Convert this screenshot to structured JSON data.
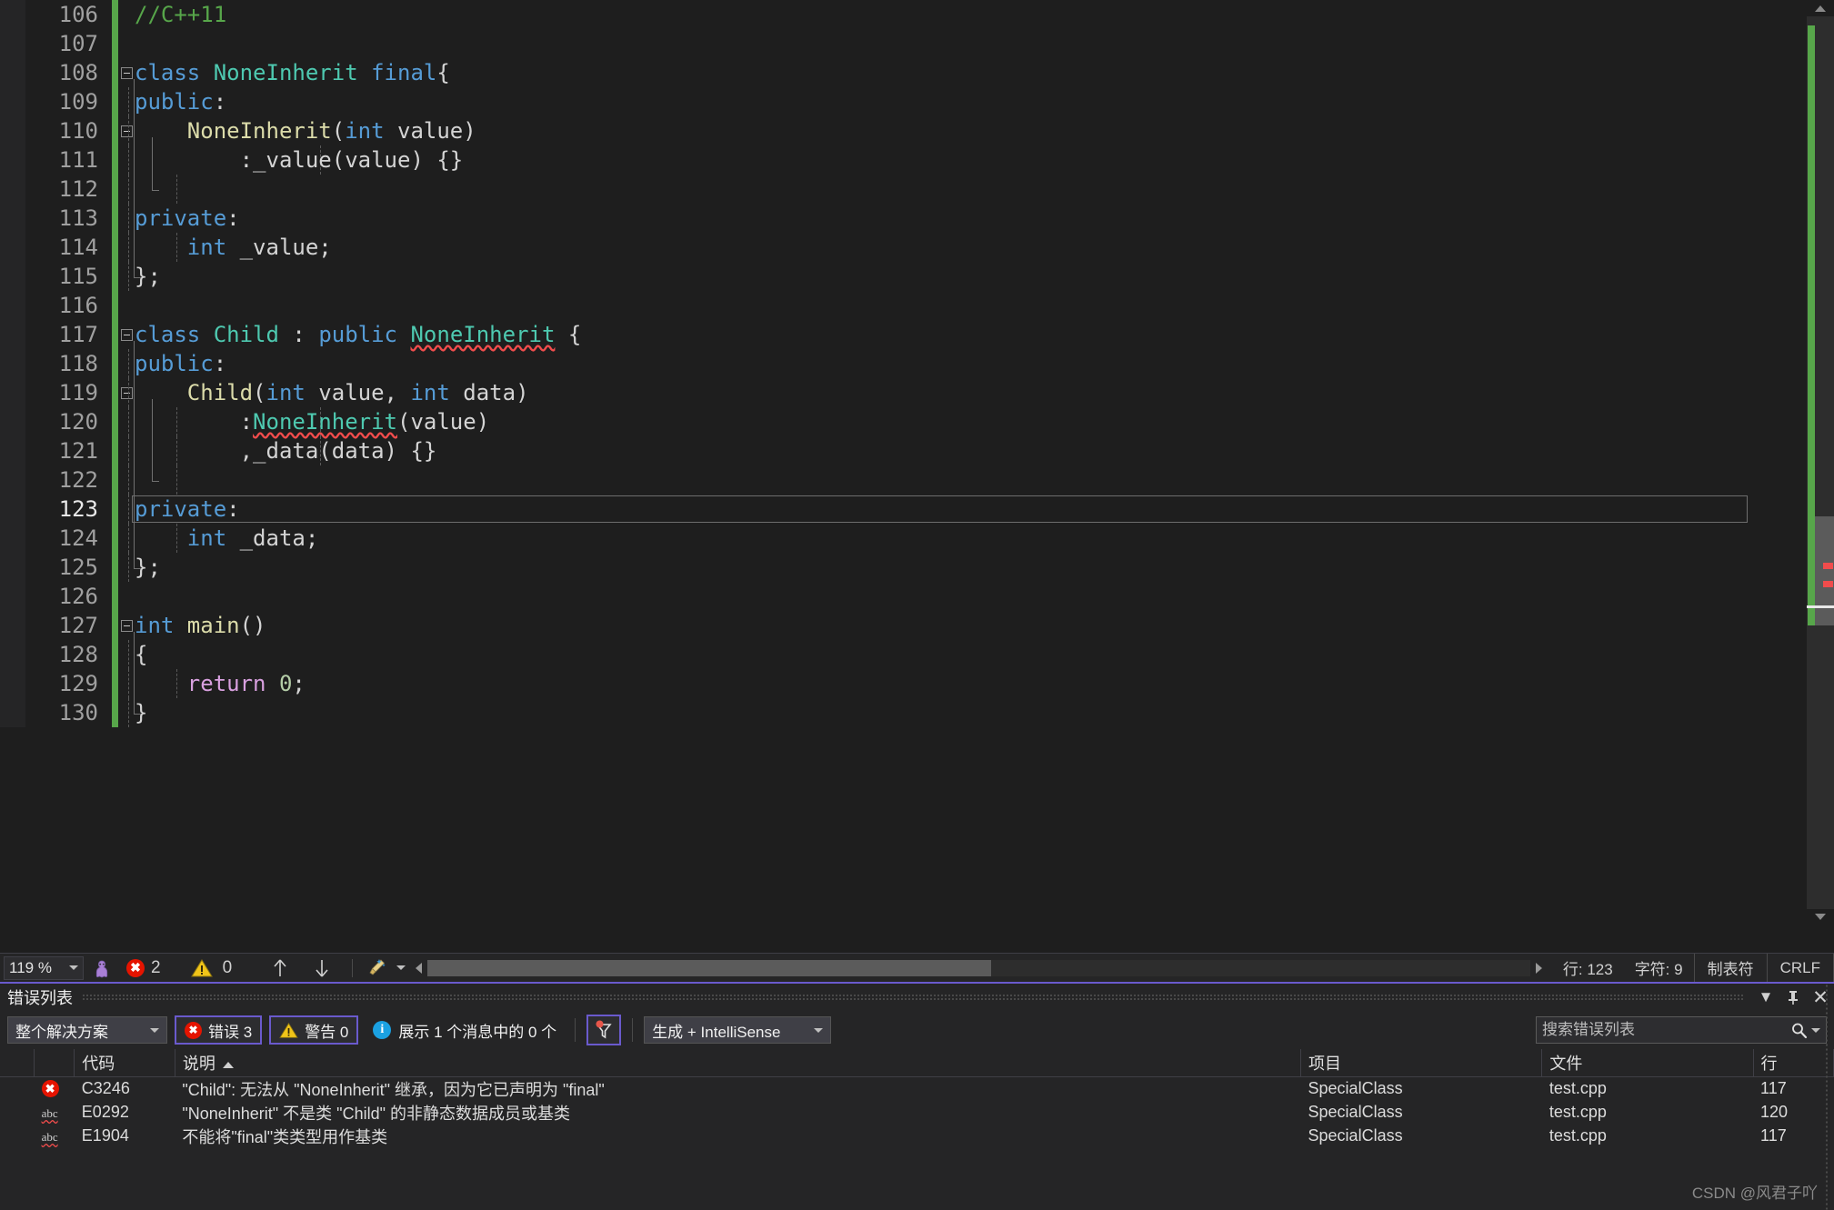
{
  "editor": {
    "first_line": 106,
    "current_line": 123,
    "lines": [
      {
        "n": 106,
        "fold": null,
        "tokens": [
          {
            "t": "//C++11",
            "c": "com"
          }
        ]
      },
      {
        "n": 107,
        "fold": null,
        "tokens": []
      },
      {
        "n": 108,
        "fold": "open",
        "tokens": [
          {
            "t": "class ",
            "c": "key"
          },
          {
            "t": "NoneInherit ",
            "c": "type"
          },
          {
            "t": "final",
            "c": "key"
          },
          {
            "t": "{",
            "c": "punct"
          }
        ]
      },
      {
        "n": 109,
        "fold": null,
        "tokens": [
          {
            "t": "public",
            "c": "key"
          },
          {
            "t": ":",
            "c": "punct"
          }
        ]
      },
      {
        "n": 110,
        "fold": "open",
        "tokens": [
          {
            "t": "    NoneInherit",
            "c": "fn"
          },
          {
            "t": "(",
            "c": "punct"
          },
          {
            "t": "int",
            "c": "key"
          },
          {
            "t": " value",
            "c": "id"
          },
          {
            "t": ")",
            "c": "punct"
          }
        ]
      },
      {
        "n": 111,
        "fold": null,
        "tokens": [
          {
            "t": "        :_value",
            "c": "id"
          },
          {
            "t": "(",
            "c": "punct"
          },
          {
            "t": "value",
            "c": "id"
          },
          {
            "t": ") {}",
            "c": "punct"
          }
        ]
      },
      {
        "n": 112,
        "fold": null,
        "tokens": []
      },
      {
        "n": 113,
        "fold": null,
        "tokens": [
          {
            "t": "private",
            "c": "key"
          },
          {
            "t": ":",
            "c": "punct"
          }
        ]
      },
      {
        "n": 114,
        "fold": null,
        "tokens": [
          {
            "t": "    int",
            "c": "key"
          },
          {
            "t": " _value;",
            "c": "id"
          }
        ]
      },
      {
        "n": 115,
        "fold": null,
        "tokens": [
          {
            "t": "};",
            "c": "punct"
          }
        ]
      },
      {
        "n": 116,
        "fold": null,
        "tokens": []
      },
      {
        "n": 117,
        "fold": "open",
        "tokens": [
          {
            "t": "class ",
            "c": "key"
          },
          {
            "t": "Child",
            "c": "type"
          },
          {
            "t": " : ",
            "c": "punct"
          },
          {
            "t": "public ",
            "c": "key"
          },
          {
            "t": "NoneInherit",
            "c": "type",
            "err": true
          },
          {
            "t": " {",
            "c": "punct"
          }
        ]
      },
      {
        "n": 118,
        "fold": null,
        "tokens": [
          {
            "t": "public",
            "c": "key"
          },
          {
            "t": ":",
            "c": "punct"
          }
        ]
      },
      {
        "n": 119,
        "fold": "open",
        "tokens": [
          {
            "t": "    Child",
            "c": "fn"
          },
          {
            "t": "(",
            "c": "punct"
          },
          {
            "t": "int",
            "c": "key"
          },
          {
            "t": " value, ",
            "c": "id"
          },
          {
            "t": "int",
            "c": "key"
          },
          {
            "t": " data",
            "c": "id"
          },
          {
            "t": ")",
            "c": "punct"
          }
        ]
      },
      {
        "n": 120,
        "fold": null,
        "tokens": [
          {
            "t": "        :",
            "c": "punct"
          },
          {
            "t": "NoneInherit",
            "c": "type",
            "err": true
          },
          {
            "t": "(",
            "c": "punct"
          },
          {
            "t": "value",
            "c": "id"
          },
          {
            "t": ")",
            "c": "punct"
          }
        ]
      },
      {
        "n": 121,
        "fold": null,
        "tokens": [
          {
            "t": "        ,_data",
            "c": "id"
          },
          {
            "t": "(",
            "c": "punct"
          },
          {
            "t": "data",
            "c": "id"
          },
          {
            "t": ") {}",
            "c": "punct"
          }
        ]
      },
      {
        "n": 122,
        "fold": null,
        "tokens": []
      },
      {
        "n": 123,
        "fold": null,
        "tokens": [
          {
            "t": "private",
            "c": "key"
          },
          {
            "t": ":",
            "c": "punct"
          }
        ]
      },
      {
        "n": 124,
        "fold": null,
        "tokens": [
          {
            "t": "    int",
            "c": "key"
          },
          {
            "t": " _data;",
            "c": "id"
          }
        ]
      },
      {
        "n": 125,
        "fold": null,
        "tokens": [
          {
            "t": "};",
            "c": "punct"
          }
        ]
      },
      {
        "n": 126,
        "fold": null,
        "tokens": []
      },
      {
        "n": 127,
        "fold": "open",
        "tokens": [
          {
            "t": "int ",
            "c": "key"
          },
          {
            "t": "main",
            "c": "fn"
          },
          {
            "t": "()",
            "c": "punct"
          }
        ]
      },
      {
        "n": 128,
        "fold": null,
        "tokens": [
          {
            "t": "{",
            "c": "punct"
          }
        ]
      },
      {
        "n": 129,
        "fold": null,
        "tokens": [
          {
            "t": "    return",
            "c": "ctrl"
          },
          {
            "t": " ",
            "c": "plain"
          },
          {
            "t": "0",
            "c": "num"
          },
          {
            "t": ";",
            "c": "punct"
          }
        ]
      },
      {
        "n": 130,
        "fold": null,
        "tokens": [
          {
            "t": "}",
            "c": "punct"
          }
        ]
      }
    ]
  },
  "statusbar": {
    "zoom": "119 %",
    "zoom_icon": "person-icon",
    "error_count": "2",
    "warning_count": "0",
    "prev_icon": "arrow-up-icon",
    "next_icon": "arrow-down-icon",
    "broom_icon": "broom-icon",
    "line_label": "行: 123",
    "char_label": "字符: 9",
    "tab_label": "制表符",
    "eol_label": "CRLF"
  },
  "errorpanel": {
    "title": "错误列表",
    "titlebar_buttons": [
      "chevron-down-icon",
      "pin-icon",
      "close-icon"
    ],
    "scope_filter": "整个解决方案",
    "errors_toggle": "错误 3",
    "warnings_toggle": "警告 0",
    "messages_toggle": "展示 1 个消息中的 0 个",
    "filter_icon": "funnel-filter-icon",
    "build_source": "生成 + IntelliSense",
    "search_placeholder": "搜索错误列表",
    "search_value": "",
    "columns": [
      "",
      "",
      "代码",
      "说明",
      "项目",
      "文件",
      "行"
    ],
    "sorted_column": "说明",
    "sort_direction": "asc",
    "rows": [
      {
        "icon": "error-icon",
        "code": "C3246",
        "description": "\"Child\": 无法从 \"NoneInherit\" 继承，因为它已声明为 \"final\"",
        "project": "SpecialClass",
        "file": "test.cpp",
        "line": "117"
      },
      {
        "icon": "intellisense-icon",
        "code": "E0292",
        "description": "\"NoneInherit\" 不是类 \"Child\" 的非静态数据成员或基类",
        "project": "SpecialClass",
        "file": "test.cpp",
        "line": "120"
      },
      {
        "icon": "intellisense-icon",
        "code": "E1904",
        "description": "不能将\"final\"类类型用作基类",
        "project": "SpecialClass",
        "file": "test.cpp",
        "line": "117"
      }
    ]
  },
  "watermark": "CSDN @风君子吖",
  "colors": {
    "accent": "#6a5acd",
    "error": "#e51400",
    "warning": "#ffcc00",
    "info": "#1ba1e2",
    "changed_line": "#57a64a",
    "keyword": "#569cd6",
    "type": "#4ec9b0",
    "comment": "#57a64a",
    "function": "#dcdcaa",
    "squiggle": "#f14c4c",
    "background": "#1e1e1e",
    "panel": "#252526"
  }
}
